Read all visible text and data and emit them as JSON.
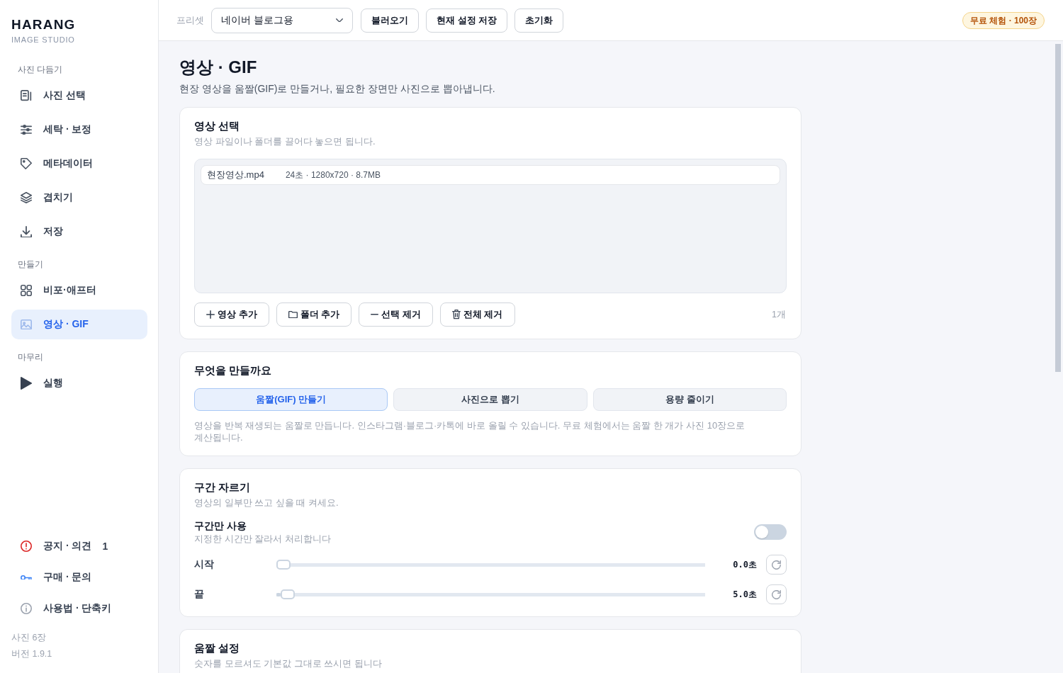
{
  "sidebar": {
    "brand": {
      "name": "HARANG",
      "tagline": "IMAGE STUDIO"
    },
    "sections": [
      {
        "title": "사진 다듬기",
        "items": [
          {
            "label": "사진 선택",
            "selected": false
          },
          {
            "label": "세탁 · 보정",
            "selected": false
          },
          {
            "label": "메타데이터",
            "selected": false
          },
          {
            "label": "겹치기",
            "selected": false
          },
          {
            "label": "저장",
            "selected": false
          }
        ]
      },
      {
        "title": "만들기",
        "items": [
          {
            "label": "비포·애프터",
            "selected": false
          },
          {
            "label": "영상 · GIF",
            "selected": true
          }
        ]
      },
      {
        "title": "마무리",
        "items": [
          {
            "label": "실행",
            "selected": false
          }
        ]
      }
    ],
    "links": [
      {
        "label": "공지 · 의견",
        "count": "1"
      },
      {
        "label": "구매 · 문의"
      },
      {
        "label": "사용법 · 단축키"
      }
    ],
    "stats": [
      "사진 6장",
      "버전 1.9.1"
    ]
  },
  "topbar": {
    "preset_label": "프리셋",
    "preset_value": "네이버 블로그용",
    "buttons": [
      "불러오기",
      "현재 설정 저장",
      "초기화"
    ],
    "plan_badge": "무료 체험 · 100장"
  },
  "page": {
    "title": "영상 · GIF",
    "subtitle": "현장 영상을 움짤(GIF)로 만들거나, 필요한 장면만 사진으로 뽑아냅니다."
  },
  "video_card": {
    "title": "영상 선택",
    "hint": "영상 파일이나 폴더를 끌어다 놓으면 됩니다.",
    "files": [
      {
        "name": "현장영상.mp4",
        "meta": "24초 · 1280x720 · 8.7MB",
        "selected": false
      }
    ],
    "actions": [
      {
        "label": "영상 추가",
        "kind": "add"
      },
      {
        "label": "폴더 추가",
        "kind": "folder"
      },
      {
        "label": "선택 제거",
        "kind": "remove"
      },
      {
        "label": "전체 제거",
        "kind": "clear"
      }
    ],
    "count": "1개"
  },
  "mode_card": {
    "title": "무엇을 만들까요",
    "options": [
      {
        "label": "움짤(GIF) 만들기",
        "selected": true
      },
      {
        "label": "사진으로 뽑기",
        "selected": false
      },
      {
        "label": "용량 줄이기",
        "selected": false
      }
    ],
    "description": "영상을 반복 재생되는 움짤로 만듭니다. 인스타그램·블로그·카톡에 바로 올릴 수 있습니다. 무료 체험에서는 움짤 한 개가 사진 10장으로 계산됩니다."
  },
  "trim_card": {
    "title": "구간 자르기",
    "hint": "영상의 일부만 쓰고 싶을 때 켜세요.",
    "toggle": {
      "label": "구간만 사용",
      "description": "지정한 시간만 잘라서 처리합니다",
      "on": false
    },
    "sliders": [
      {
        "label": "시작",
        "level": 0,
        "reading": "0.0초"
      },
      {
        "label": "끝",
        "level": 0.01,
        "reading": "5.0초"
      }
    ]
  },
  "gif_settings_card": {
    "title": "움짤 설정",
    "hint": "숫자를 모르셔도 기본값 그대로 쓰시면 됩니다"
  }
}
